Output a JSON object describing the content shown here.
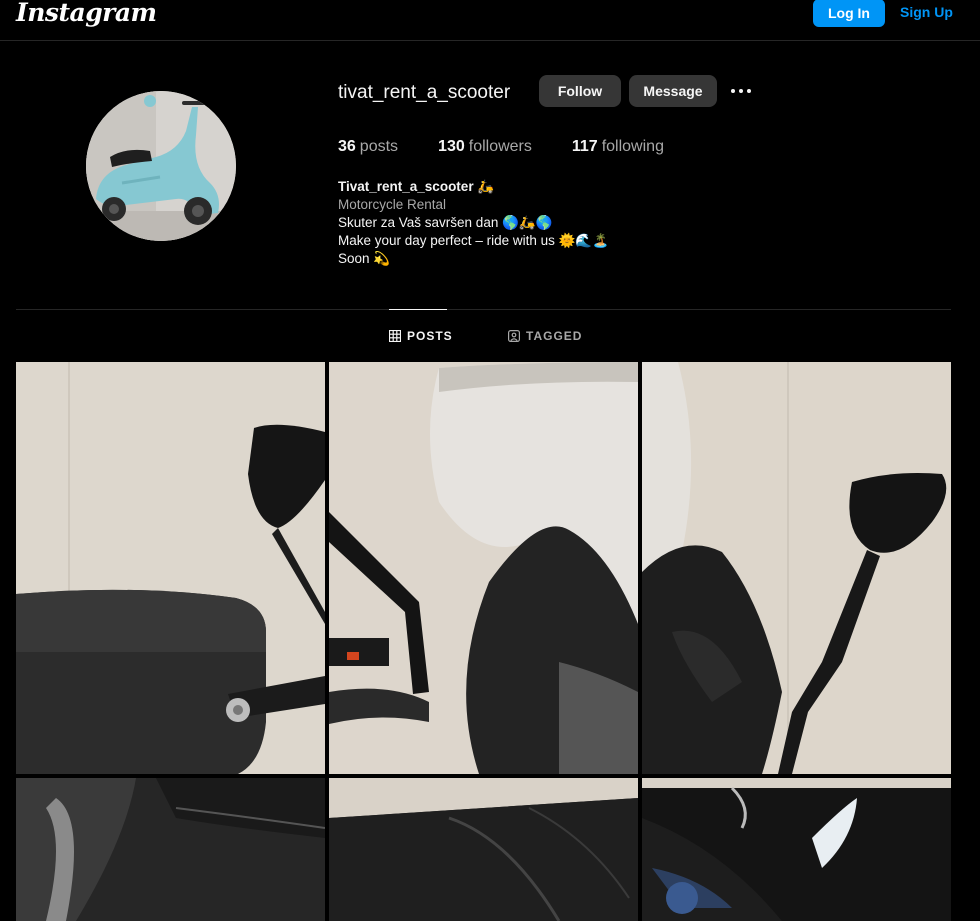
{
  "nav": {
    "logo": "Instagram",
    "login_label": "Log In",
    "signup_label": "Sign Up"
  },
  "profile": {
    "username": "tivat_rent_a_scooter",
    "follow_label": "Follow",
    "message_label": "Message",
    "stats": {
      "posts_count": "36",
      "posts_label": "posts",
      "followers_count": "130",
      "followers_label": "followers",
      "following_count": "117",
      "following_label": "following"
    },
    "bio": {
      "name": "Tivat_rent_a_scooter 🛵",
      "category": "Motorcycle Rental",
      "line1": "Skuter za Vaš savršen dan 🌎🛵🌎",
      "line2": "Make your day perfect – ride with us 🌞🌊🏝️",
      "line3": "Soon 💫"
    }
  },
  "tabs": {
    "posts_label": "POSTS",
    "tagged_label": "TAGGED"
  },
  "colors": {
    "accent": "#0095f6",
    "button_bg": "#363636",
    "background": "#000000",
    "muted_text": "#a8a8a8"
  }
}
